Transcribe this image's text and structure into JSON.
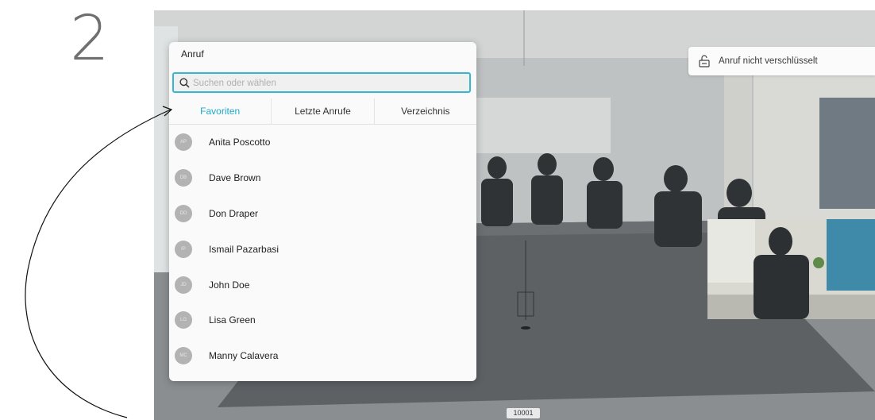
{
  "step": {
    "number": "2"
  },
  "call_panel": {
    "title": "Anruf",
    "search": {
      "placeholder": "Suchen oder wählen",
      "value": ""
    },
    "tabs": [
      {
        "label": "Favoriten",
        "active": true
      },
      {
        "label": "Letzte Anrufe",
        "active": false
      },
      {
        "label": "Verzeichnis",
        "active": false
      }
    ],
    "contacts": [
      {
        "initials": "AP",
        "name": "Anita Poscotto"
      },
      {
        "initials": "DB",
        "name": "Dave Brown"
      },
      {
        "initials": "DD",
        "name": "Don Draper"
      },
      {
        "initials": "IP",
        "name": "Ismail Pazarbasi"
      },
      {
        "initials": "JD",
        "name": "John Doe"
      },
      {
        "initials": "LG",
        "name": "Lisa Green"
      },
      {
        "initials": "MC",
        "name": "Manny Calavera"
      }
    ]
  },
  "status": {
    "encryption_text": "Anruf nicht verschlüsselt",
    "icon": "unlocked-padlock-icon"
  },
  "call_id": "10001",
  "colors": {
    "accent": "#37b6d0",
    "active_tab": "#1fa9c9",
    "avatar": "#b3b3b3"
  }
}
